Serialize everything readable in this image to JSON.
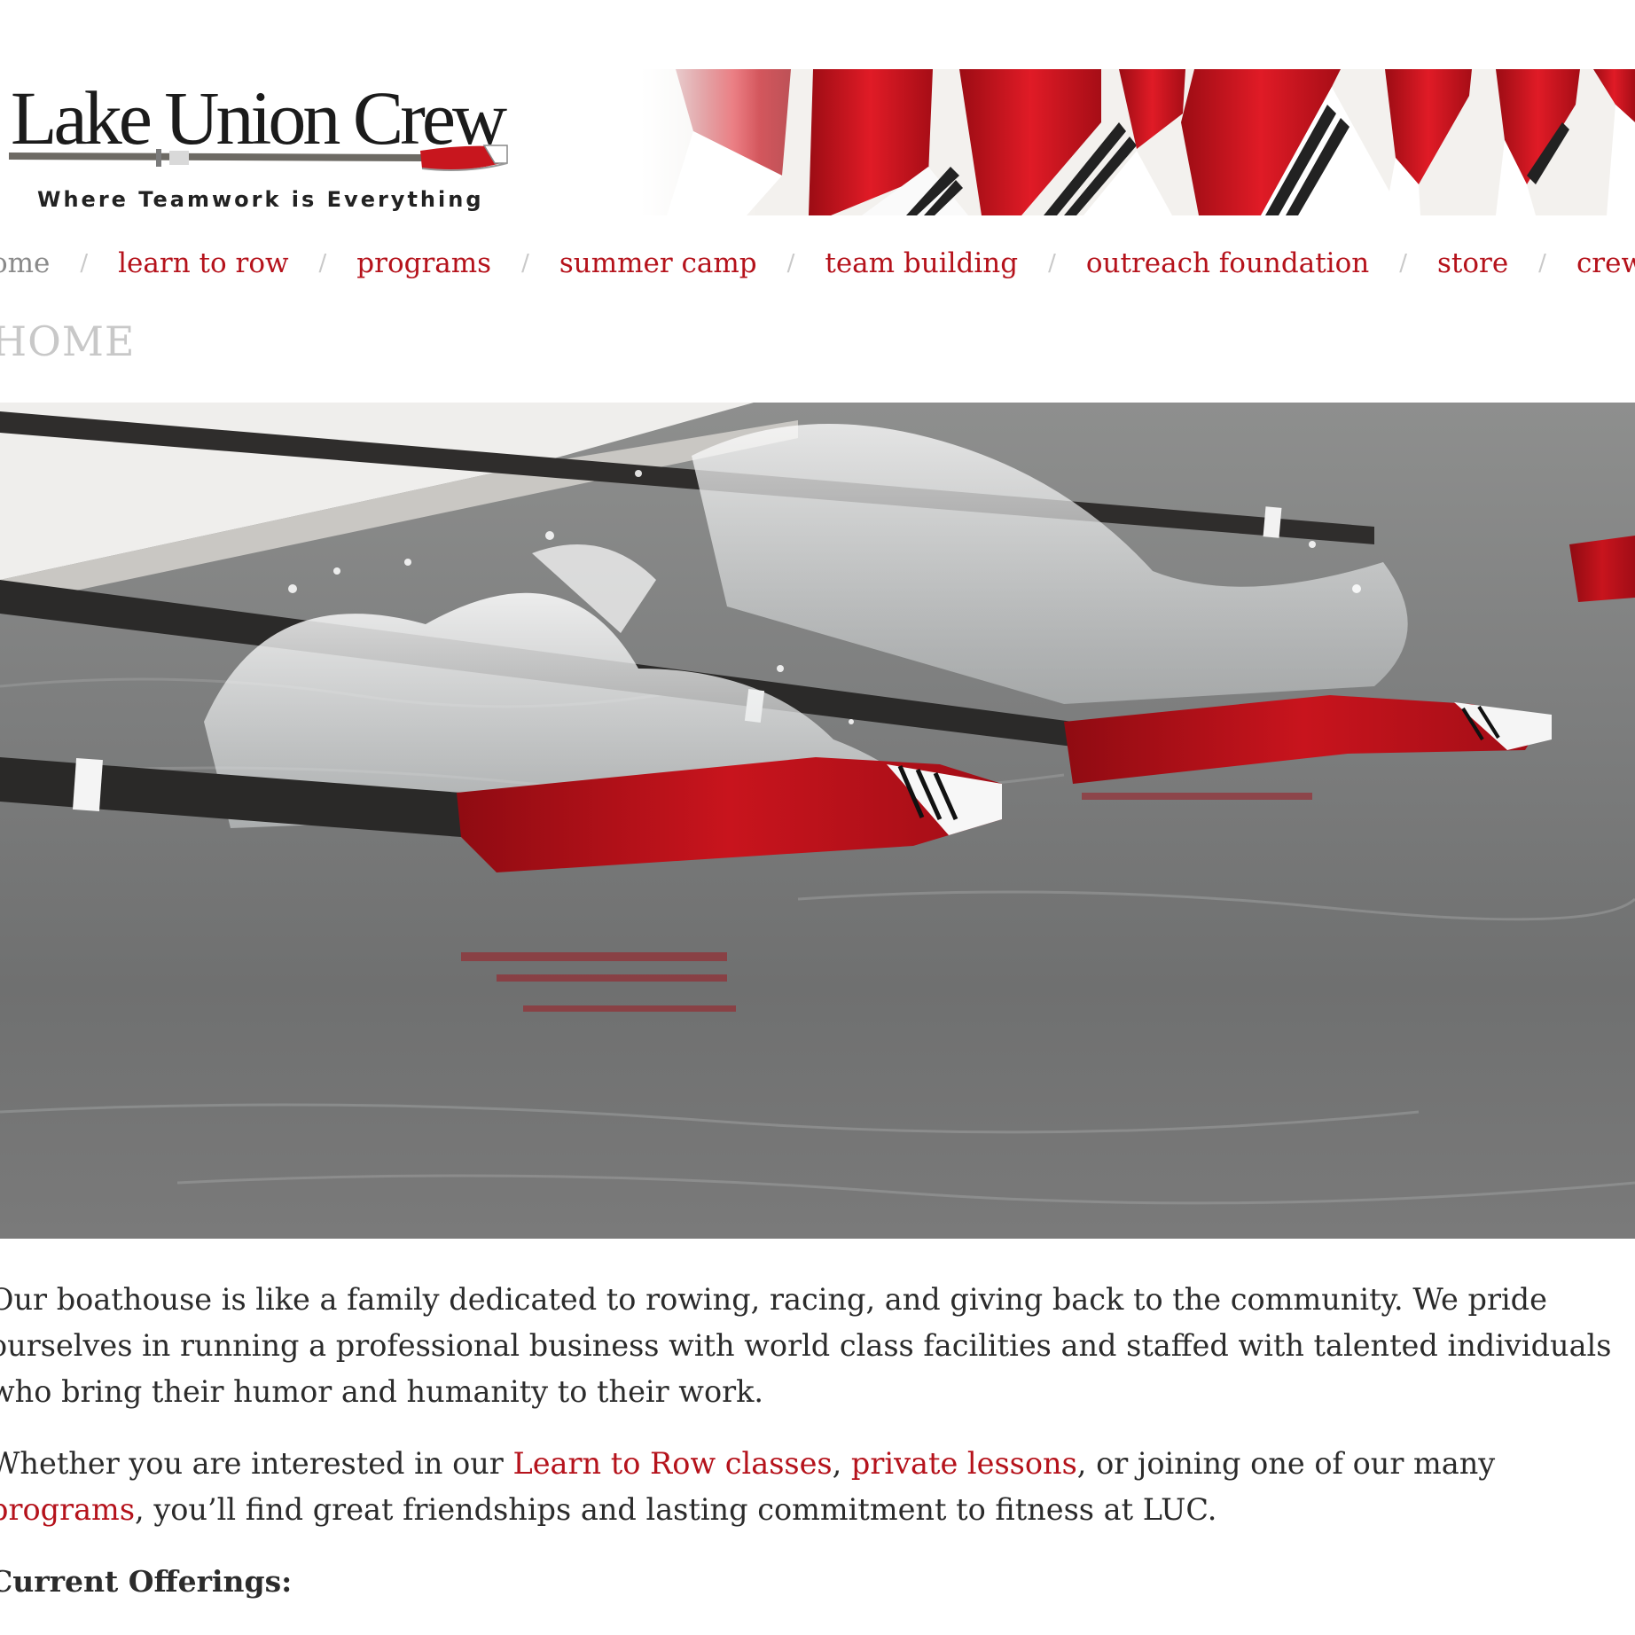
{
  "site": {
    "logo_title": "Lake Union Crew",
    "logo_tagline": "Where Teamwork is Everything"
  },
  "nav": {
    "items": [
      {
        "label": "home",
        "current": true
      },
      {
        "label": "learn to row"
      },
      {
        "label": "programs"
      },
      {
        "label": "summer camp"
      },
      {
        "label": "team building"
      },
      {
        "label": "outreach foundation"
      },
      {
        "label": "store"
      },
      {
        "label": "crew cam"
      }
    ],
    "separator": "/"
  },
  "page_title": "HOME",
  "intro": {
    "paragraph1": "Our boathouse is like a family dedicated to rowing, racing, and giving back to the community. We pride ourselves in running a professional business with world class facilities and staffed with talented individuals who bring their humor and humanity to their work.",
    "p2_before": "Whether you are interested in our ",
    "p2_link1": "Learn to Row classes",
    "p2_mid1": ", ",
    "p2_link2": "private lessons",
    "p2_mid2": ", or joining one of our many ",
    "p2_link3": "programs",
    "p2_after": ", you’ll find great friendships and lasting commitment to fitness at LUC.",
    "offerings_heading": "Current Offerings:"
  },
  "colors": {
    "accent": "#b5121b",
    "nav_current": "#8a8a8a",
    "title_gray": "#c8c8c8",
    "body_text": "#2b2b2b"
  },
  "images": {
    "header_banner": "red-and-white-oar-blades-icon",
    "hero": "oars-splashing-water-photo-icon"
  }
}
